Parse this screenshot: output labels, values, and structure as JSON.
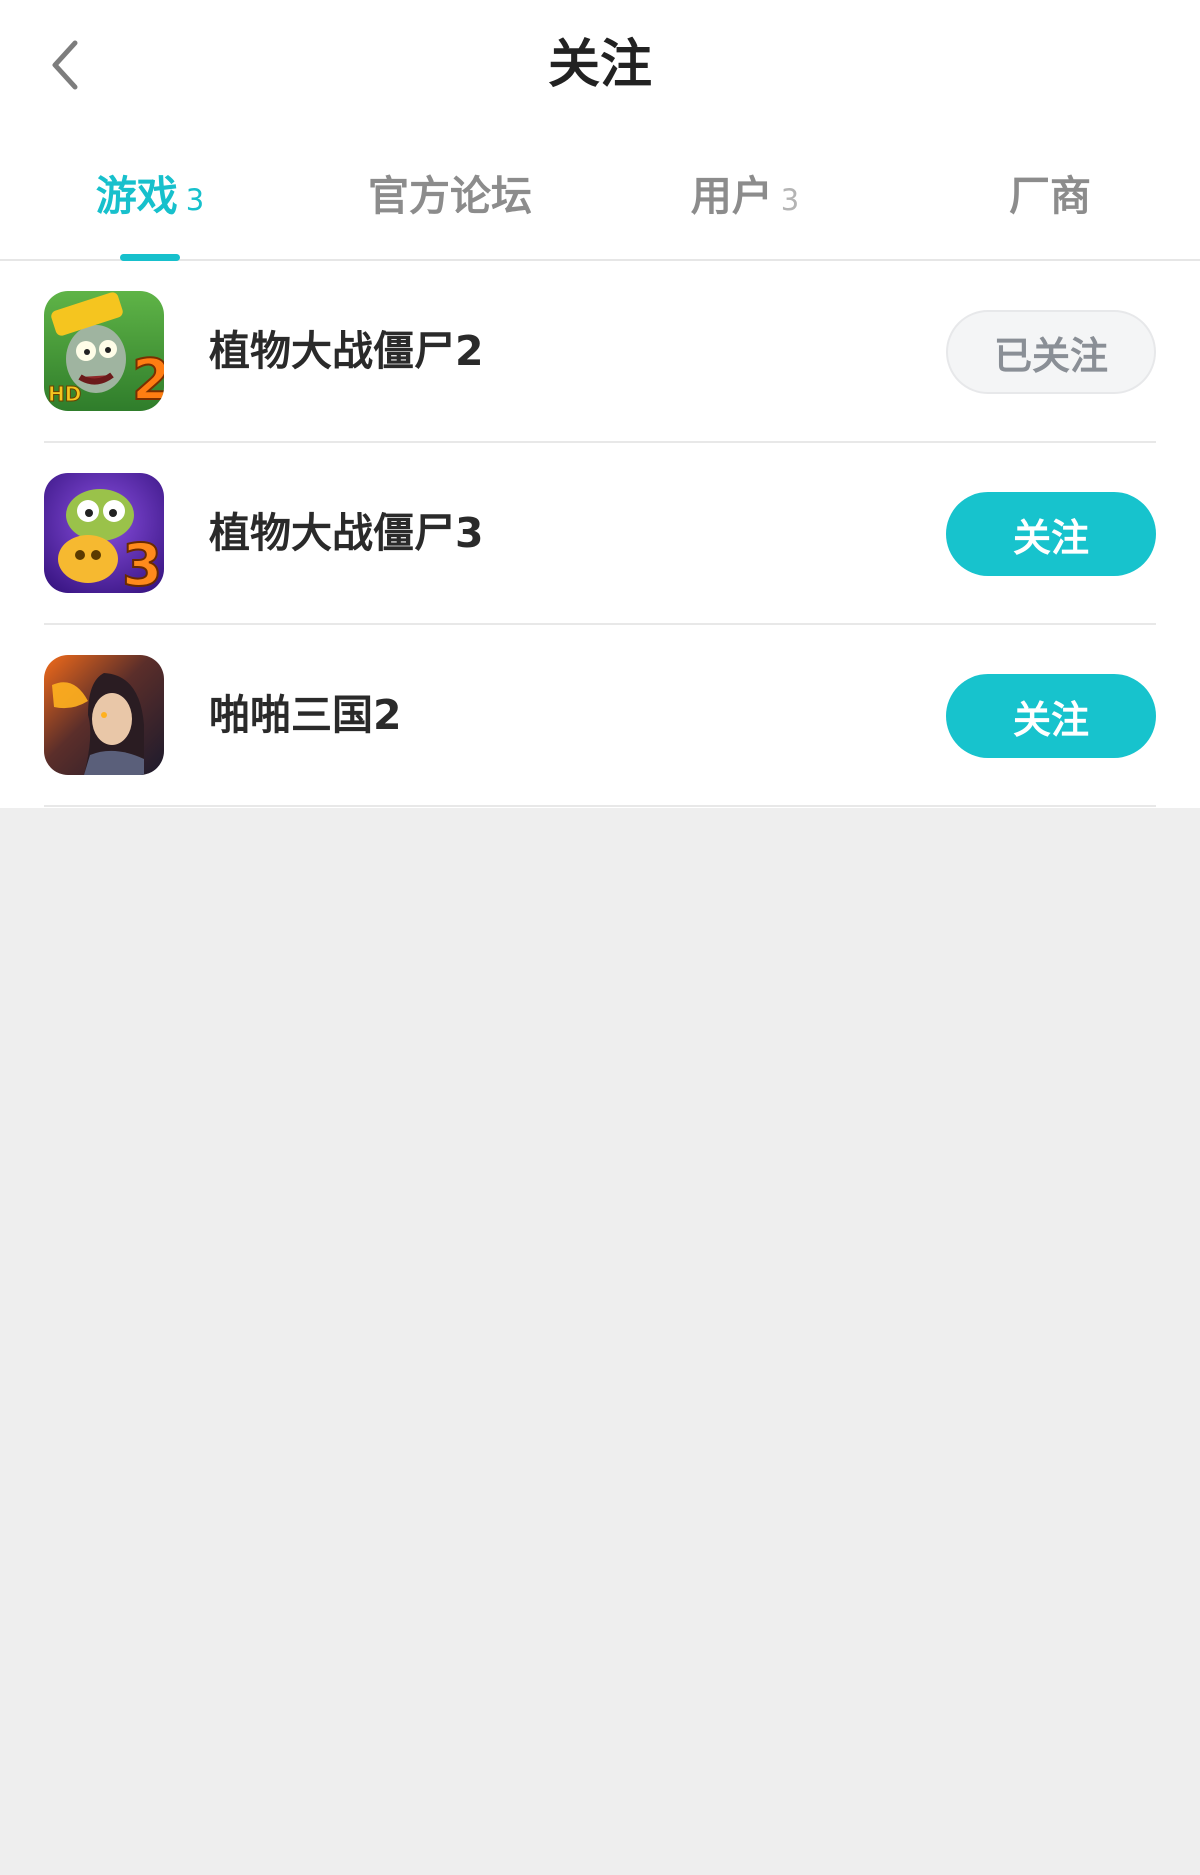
{
  "header": {
    "title": "关注",
    "back_icon": "chevron-left-icon"
  },
  "tabs": [
    {
      "label": "游戏",
      "count": "3",
      "active": true
    },
    {
      "label": "官方论坛",
      "count": "",
      "active": false
    },
    {
      "label": "用户",
      "count": "3",
      "active": false
    },
    {
      "label": "厂商",
      "count": "",
      "active": false
    }
  ],
  "colors": {
    "accent": "#17c0cc",
    "inactive_tab": "#8c8c8c",
    "background": "#eeeeee"
  },
  "list": {
    "items": [
      {
        "name": "植物大战僵尸2",
        "button_label": "已关注",
        "followed": true,
        "icon": "pvz2-game-icon"
      },
      {
        "name": "植物大战僵尸3",
        "button_label": "关注",
        "followed": false,
        "icon": "pvz3-game-icon"
      },
      {
        "name": "啪啪三国2",
        "button_label": "关注",
        "followed": false,
        "icon": "papa-sanguo2-game-icon"
      }
    ]
  }
}
